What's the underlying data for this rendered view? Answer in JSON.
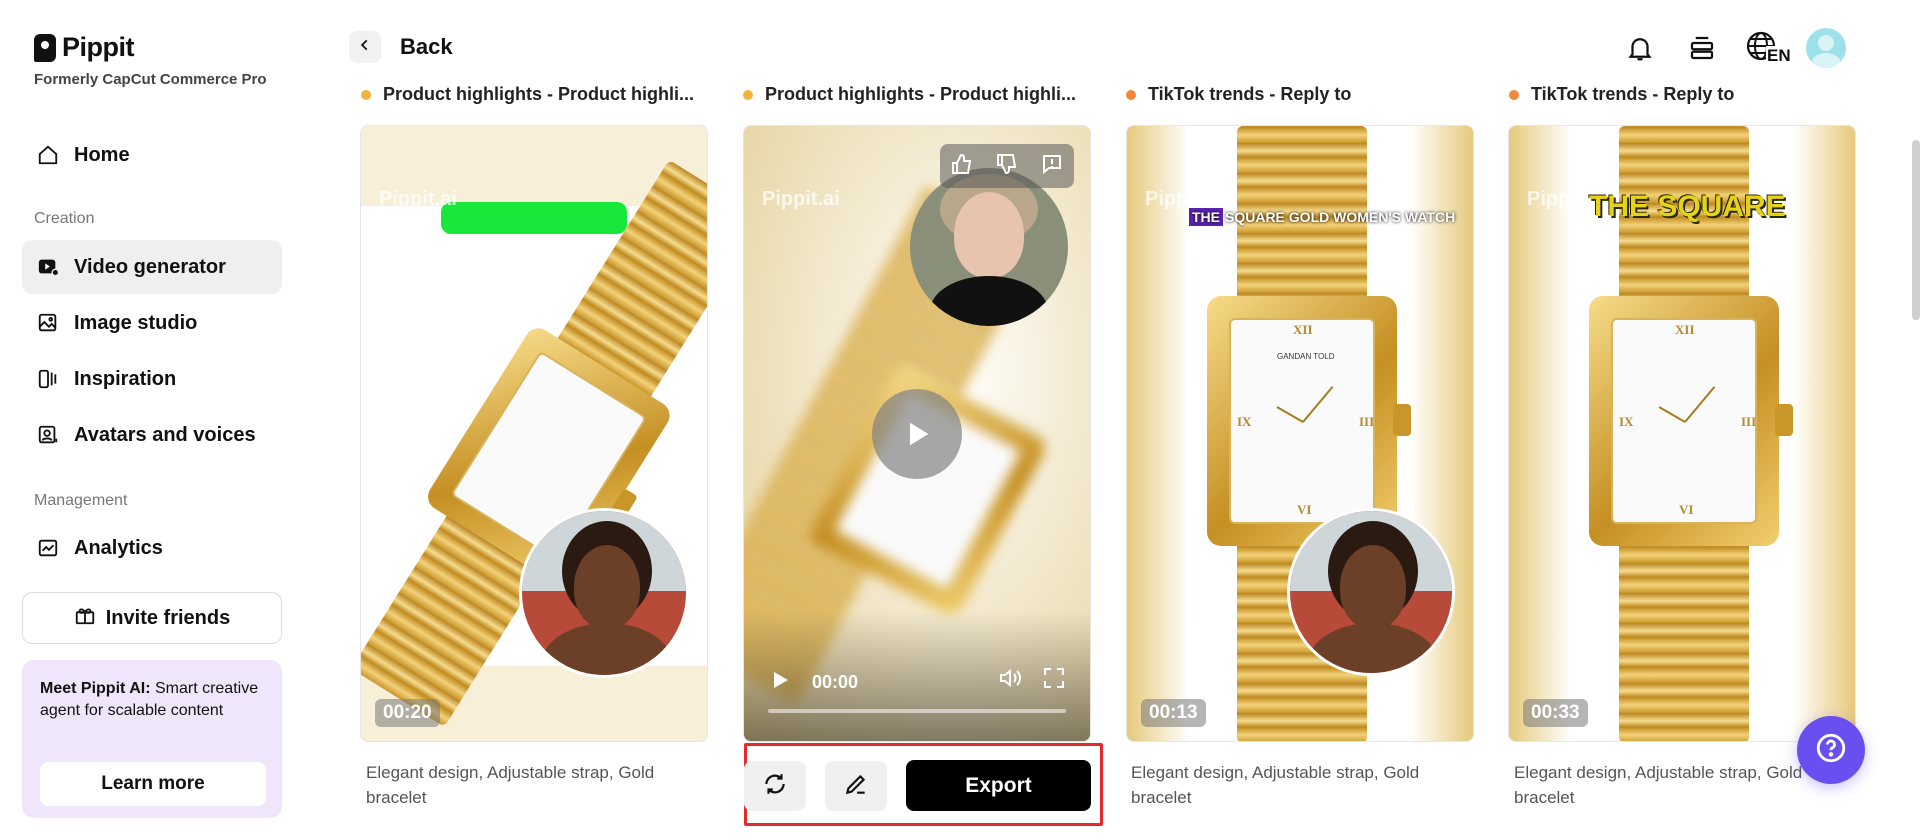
{
  "brand": {
    "name": "Pippit",
    "subtitle": "Formerly CapCut Commerce Pro"
  },
  "sidebar": {
    "home": "Home",
    "section_creation": "Creation",
    "items_creation": [
      {
        "label": "Video generator",
        "icon": "video-generator-icon",
        "active": true
      },
      {
        "label": "Image studio",
        "icon": "image-studio-icon",
        "active": false
      },
      {
        "label": "Inspiration",
        "icon": "inspiration-icon",
        "active": false
      },
      {
        "label": "Avatars and voices",
        "icon": "avatar-voice-icon",
        "active": false
      }
    ],
    "section_management": "Management",
    "analytics": "Analytics",
    "invite": "Invite friends",
    "promo": {
      "title": "Meet Pippit AI:",
      "body": " Smart creative agent for scalable content",
      "cta": "Learn more"
    }
  },
  "header": {
    "back": "Back",
    "icons": [
      "bell-icon",
      "layers-icon",
      "language-icon",
      "avatar"
    ],
    "language": "EN"
  },
  "cards": [
    {
      "title": "Product highlights - Product highli...",
      "duration": "00:20",
      "watermark": "Pippit.ai",
      "description": "Elegant design, Adjustable strap, Gold bracelet"
    },
    {
      "title": "Product highlights - Product highli...",
      "watermark": "Pippit.ai",
      "player_time": "00:00",
      "description": ""
    },
    {
      "title": "TikTok trends - Reply to",
      "duration": "00:13",
      "watermark": "Pippit.ai",
      "overlay": "THE SQUARE GOLD WOMEN'S WATCH",
      "overlay_badge": "THE",
      "description": "Elegant design, Adjustable strap, Gold bracelet"
    },
    {
      "title": "TikTok trends - Reply to",
      "duration": "00:33",
      "watermark": "Pippit",
      "overlay": "THE SQUARE",
      "description": "Elegant design, Adjustable strap, Gold bracelet"
    }
  ],
  "actions": {
    "export": "Export"
  },
  "watch_dial_brand": "GANDAN TOLD"
}
